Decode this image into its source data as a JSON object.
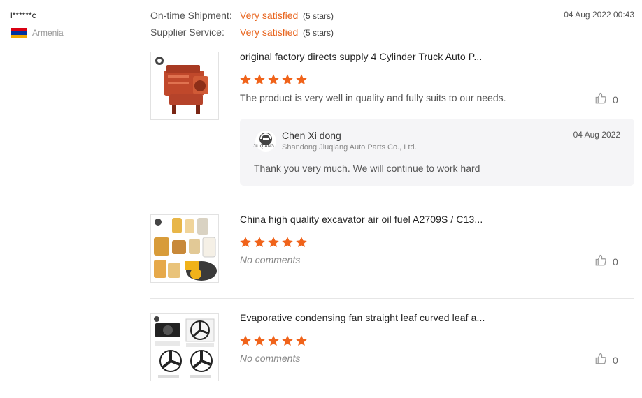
{
  "reviewer": {
    "name": "l******c",
    "country": "Armenia",
    "flag_colors": [
      "#d90012",
      "#0033a0",
      "#f2a800"
    ]
  },
  "ratings": [
    {
      "label": "On-time Shipment:",
      "value": "Very satisfied",
      "stars_text": "(5 stars)"
    },
    {
      "label": "Supplier Service:",
      "value": "Very satisfied",
      "stars_text": "(5 stars)"
    }
  ],
  "review_date": "04 Aug 2022 00:43",
  "star_color": "#f0631a",
  "products": [
    {
      "title": "original factory directs supply 4 Cylinder Truck Auto P...",
      "stars": 5,
      "comment": "The product is very well in quality and fully suits to our needs.",
      "likes": "0",
      "image": "engine"
    },
    {
      "title": "China high quality excavator air oil fuel A2709S / C13...",
      "stars": 5,
      "comment": "No comments",
      "likes": "0",
      "image": "filters"
    },
    {
      "title": "Evaporative condensing fan straight leaf curved leaf a...",
      "stars": 5,
      "comment": "No comments",
      "likes": "0",
      "image": "fans"
    }
  ],
  "reply": {
    "name": "Chen Xi dong",
    "company": "Shandong Jiuqiang Auto Parts Co., Ltd.",
    "date": "04 Aug 2022",
    "text": "Thank you very much. We will continue to work hard",
    "logo_text": "JIUQIANG"
  }
}
